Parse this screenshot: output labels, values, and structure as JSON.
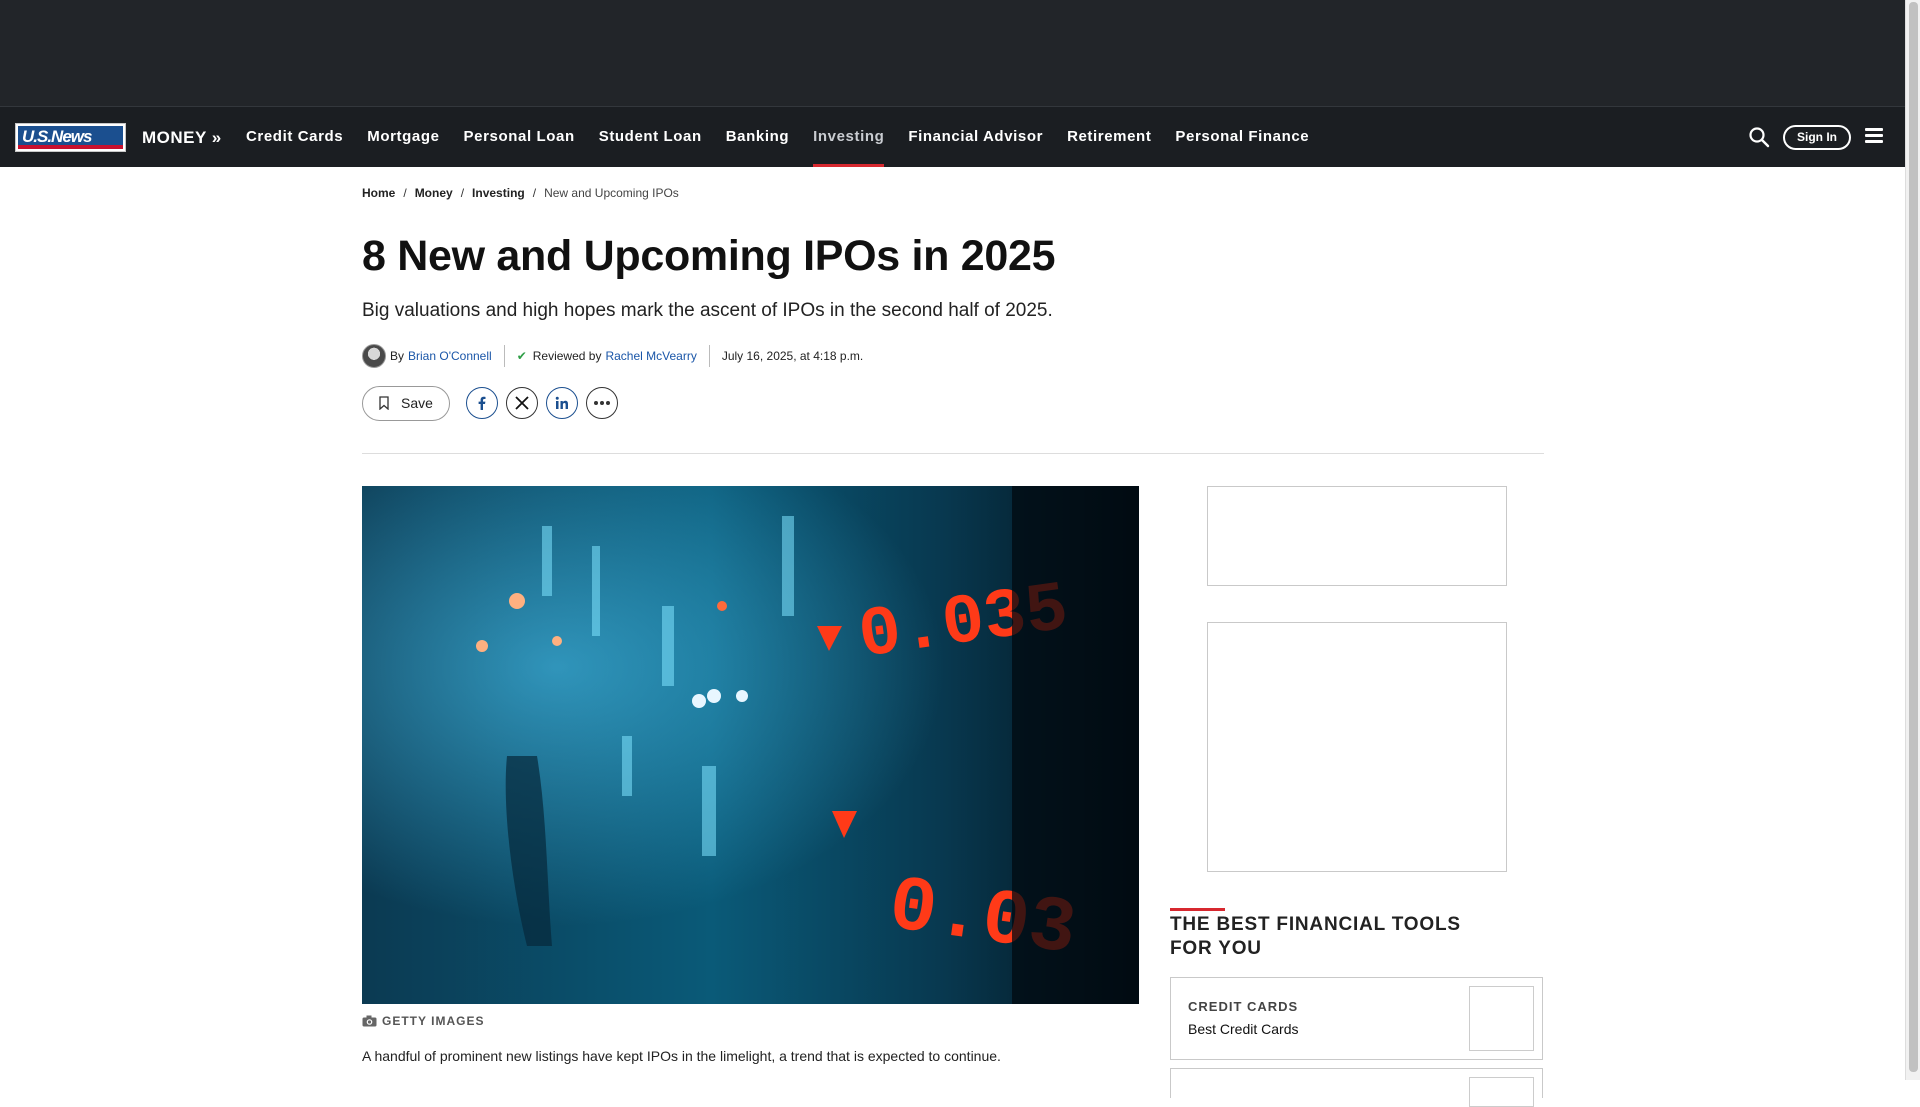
{
  "site": {
    "logo_text": "U.S.News",
    "section": "MONEY »"
  },
  "nav": {
    "items": [
      "Credit Cards",
      "Mortgage",
      "Personal Loan",
      "Student Loan",
      "Banking",
      "Investing",
      "Financial Advisor",
      "Retirement",
      "Personal Finance"
    ],
    "active": "Investing",
    "sign_in": "Sign In"
  },
  "breadcrumb": {
    "home": "Home",
    "money": "Money",
    "investing": "Investing",
    "current": "New and Upcoming IPOs",
    "sep": "/"
  },
  "article": {
    "title": "8 New and Upcoming IPOs in 2025",
    "subtitle": "Big valuations and high hopes mark the ascent of IPOs in the second half of 2025.",
    "by_label": "By",
    "author": "Brian O'Connell",
    "reviewed_label": "Reviewed by",
    "reviewer": "Rachel McVearry",
    "date": "July 16, 2025, at 4:18 p.m.",
    "save_label": "Save",
    "image_caption": "GETTY IMAGES",
    "first_paragraph": "A handful of prominent new listings have kept IPOs in the limelight, a trend that is expected to continue."
  },
  "hero_ticker": {
    "value_top": "0.035",
    "value_bottom": "0.03"
  },
  "sidebar": {
    "tools_heading": "THE BEST FINANCIAL TOOLS FOR YOU",
    "cards": [
      {
        "category": "CREDIT CARDS",
        "name": "Best Credit Cards"
      }
    ]
  },
  "colors": {
    "nav_bg": "#1b1e22",
    "accent_red": "#d7282f",
    "link_blue": "#1a56a8",
    "check_green": "#2e9e46"
  },
  "icons": [
    "search-icon",
    "menu-icon",
    "bookmark-icon",
    "facebook-icon",
    "x-icon",
    "linkedin-icon",
    "more-icon",
    "camera-icon",
    "check-icon"
  ]
}
